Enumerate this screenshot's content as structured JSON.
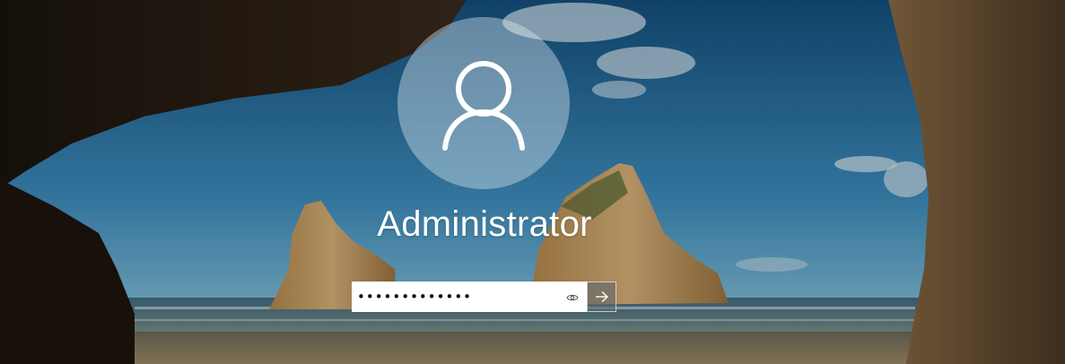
{
  "lockscreen": {
    "username": "Administrator",
    "password": {
      "value": "•••••••••••••",
      "masked": true
    },
    "icons": {
      "avatar": "user-silhouette-icon",
      "reveal": "eye-icon",
      "submit": "arrow-right-icon"
    },
    "colors": {
      "field_background": "#ffffff",
      "text": "#ffffff",
      "avatar_background": "rgba(220,230,238,0.42)"
    }
  }
}
